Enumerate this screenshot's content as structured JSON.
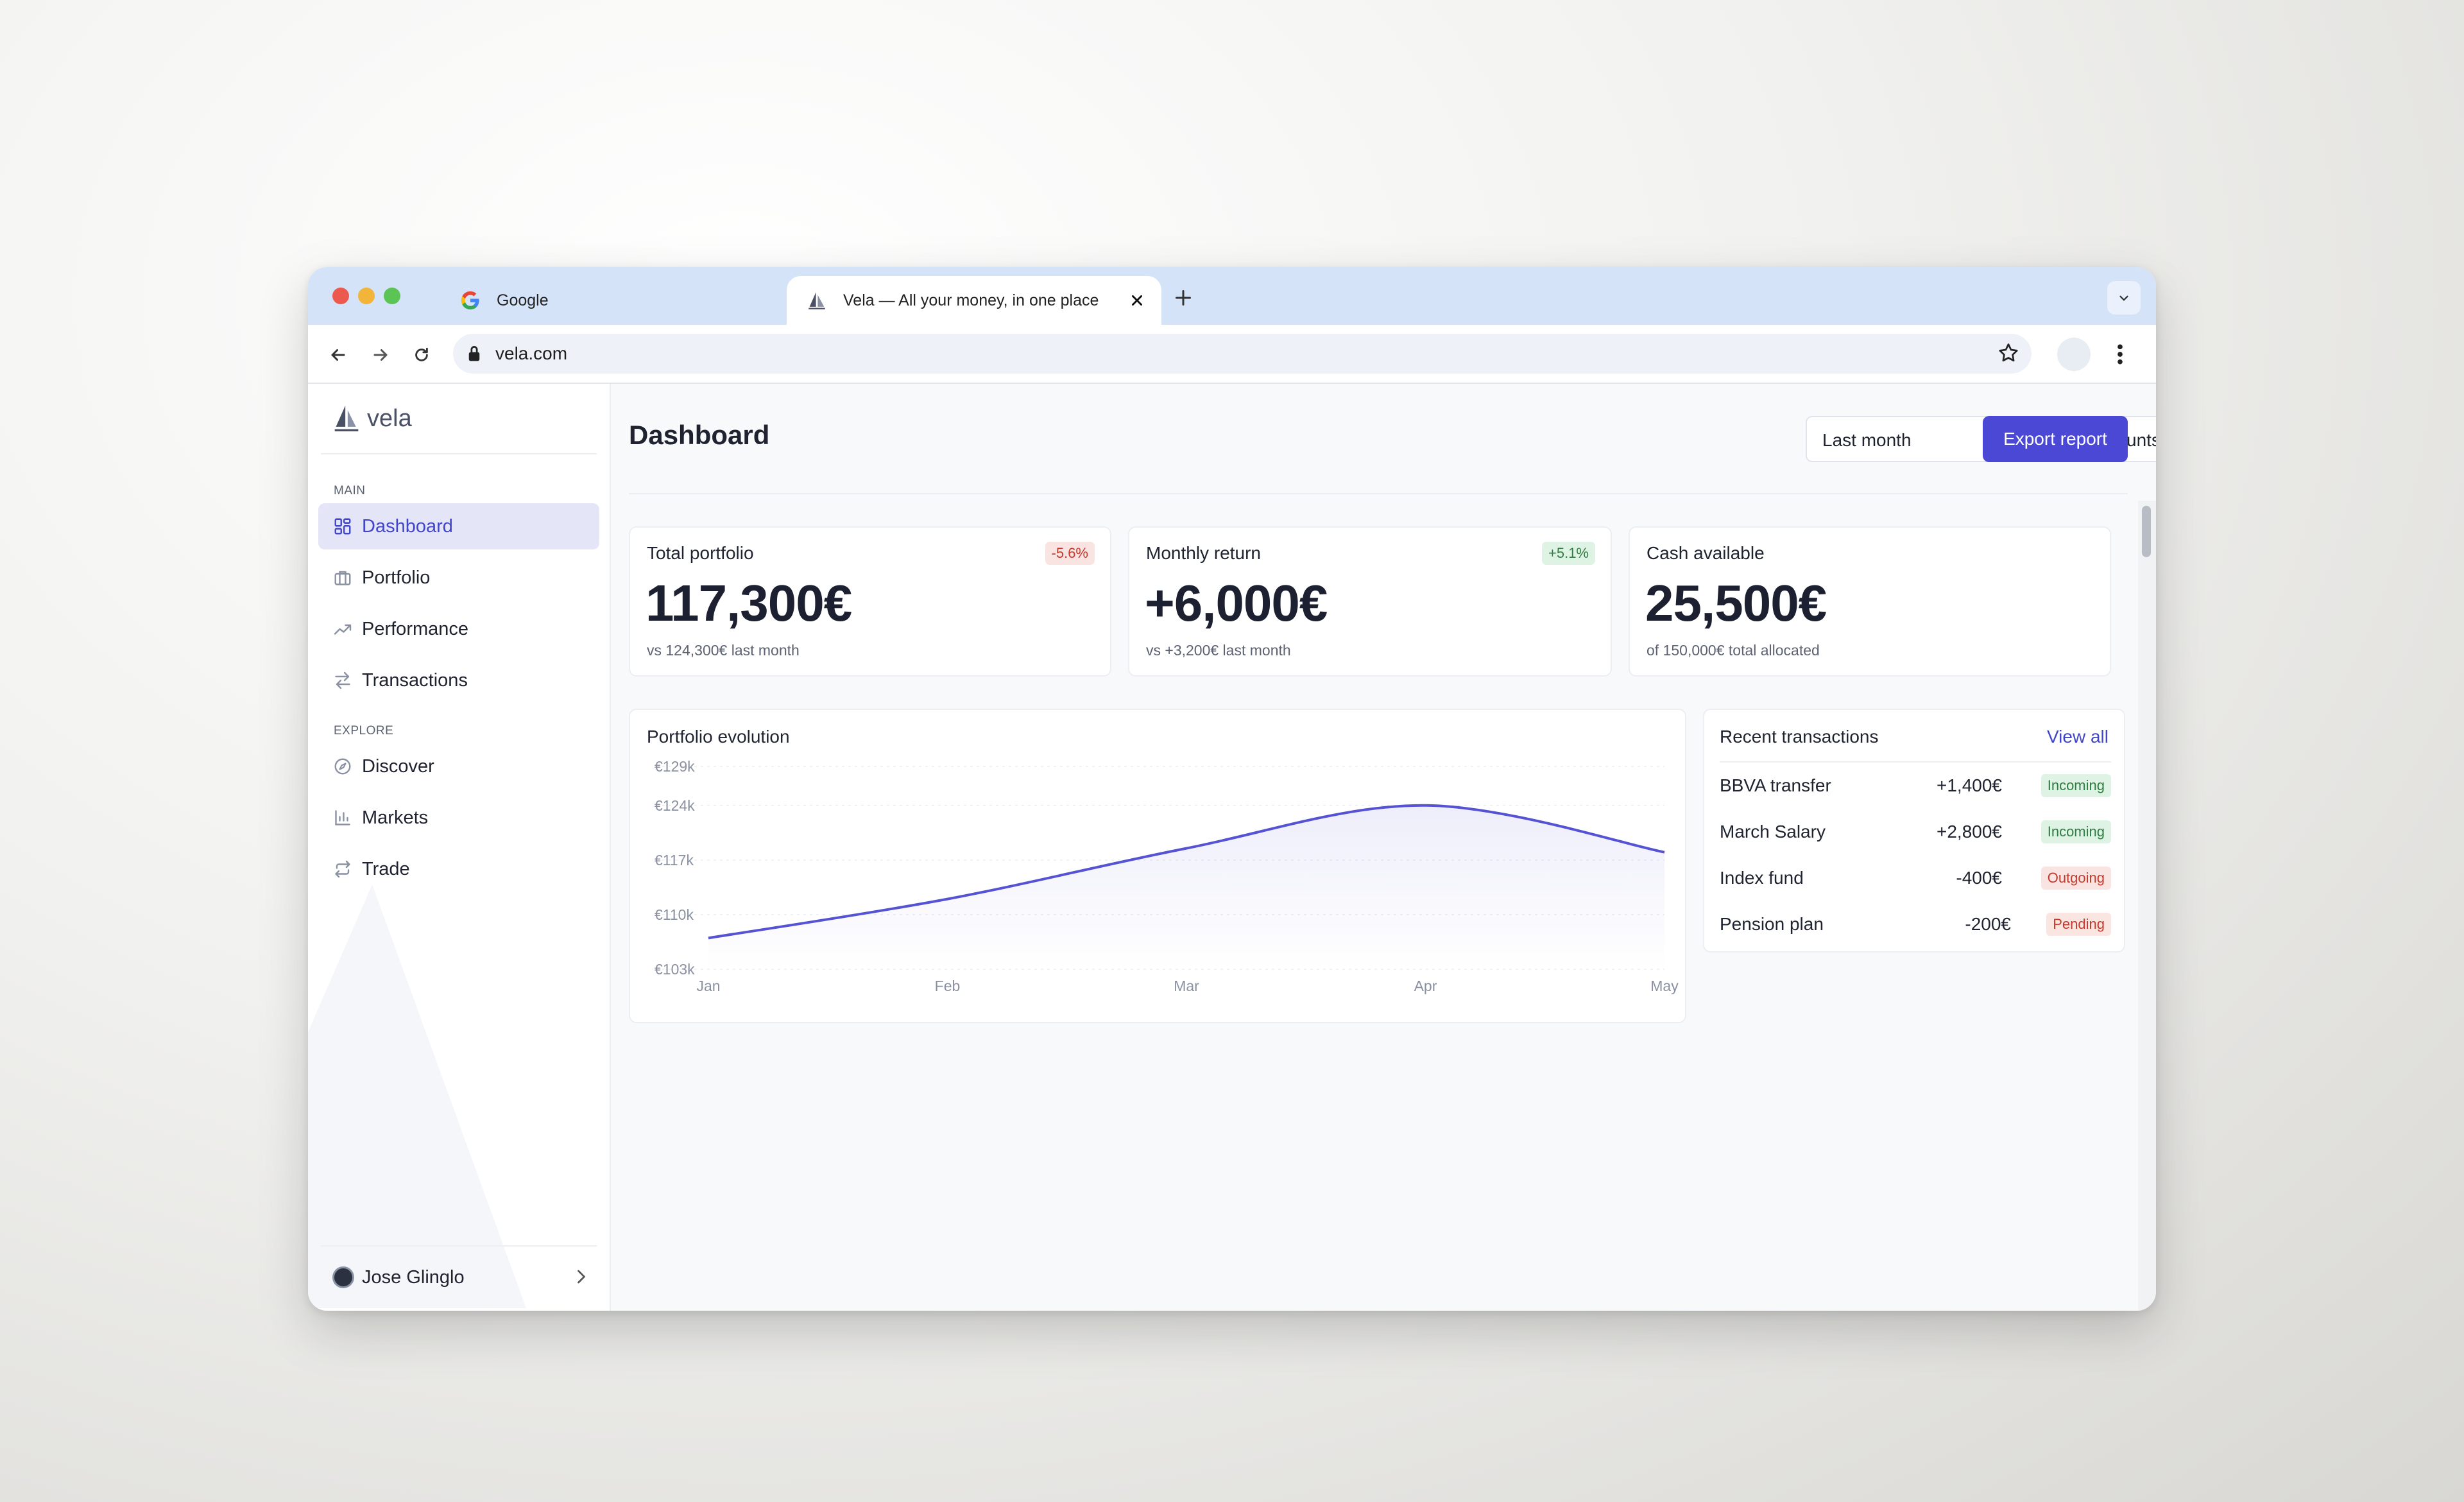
{
  "browser": {
    "tabs": [
      {
        "title": "Google",
        "icon": "google-icon"
      },
      {
        "title": "Vela — All your money, in one place",
        "icon": "sailboat-icon"
      }
    ],
    "url": "vela.com"
  },
  "sidebar": {
    "brand": "vela",
    "sections": [
      {
        "label": "MAIN",
        "items": [
          {
            "label": "Dashboard",
            "icon": "grid-icon",
            "active": true
          },
          {
            "label": "Portfolio",
            "icon": "briefcase-icon"
          },
          {
            "label": "Performance",
            "icon": "trending-up-icon"
          },
          {
            "label": "Transactions",
            "icon": "swap-icon"
          }
        ]
      },
      {
        "label": "EXPLORE",
        "items": [
          {
            "label": "Discover",
            "icon": "compass-icon"
          },
          {
            "label": "Markets",
            "icon": "bar-chart-icon"
          },
          {
            "label": "Trade",
            "icon": "repeat-icon"
          }
        ]
      }
    ],
    "user": {
      "name": "Jose Glinglo"
    }
  },
  "header": {
    "title": "Dashboard",
    "period_select": "Last month",
    "account_select": "All accounts",
    "export_label": "Export report"
  },
  "kpis": [
    {
      "label": "Total portfolio",
      "value": "117,300€",
      "sub": "vs 124,300€ last month",
      "badge": "-5.6%"
    },
    {
      "label": "Monthly return",
      "value": "+6,000€",
      "sub": "vs +3,200€ last month",
      "badge": "+5.1%"
    },
    {
      "label": "Cash available",
      "value": "25,500€",
      "sub": "of 150,000€ total allocated",
      "badge": ""
    }
  ],
  "chart": {
    "title": "Portfolio evolution"
  },
  "chart_data": {
    "type": "line",
    "title": "Portfolio evolution",
    "x": [
      "Jan",
      "Feb",
      "Mar",
      "Apr",
      "May"
    ],
    "y_ticks": [
      "€129k",
      "€124k",
      "€117k",
      "€110k",
      "€103k"
    ],
    "series": [
      {
        "values": [
          107000,
          112000,
          118500,
          124000,
          118000
        ]
      }
    ],
    "ylim": [
      103000,
      129000
    ],
    "color": "#5552d3",
    "grid": true
  },
  "transactions": {
    "title": "Recent transactions",
    "view_all": "View all",
    "rows": [
      {
        "name": "BBVA transfer",
        "amount": "+1,400€",
        "status": "Incoming"
      },
      {
        "name": "March Salary",
        "amount": "+2,800€",
        "status": "Incoming"
      },
      {
        "name": "Index fund",
        "amount": "-400€",
        "status": "Outgoing"
      },
      {
        "name": "Pension plan",
        "amount": "-200€",
        "status": "Pending"
      }
    ]
  }
}
